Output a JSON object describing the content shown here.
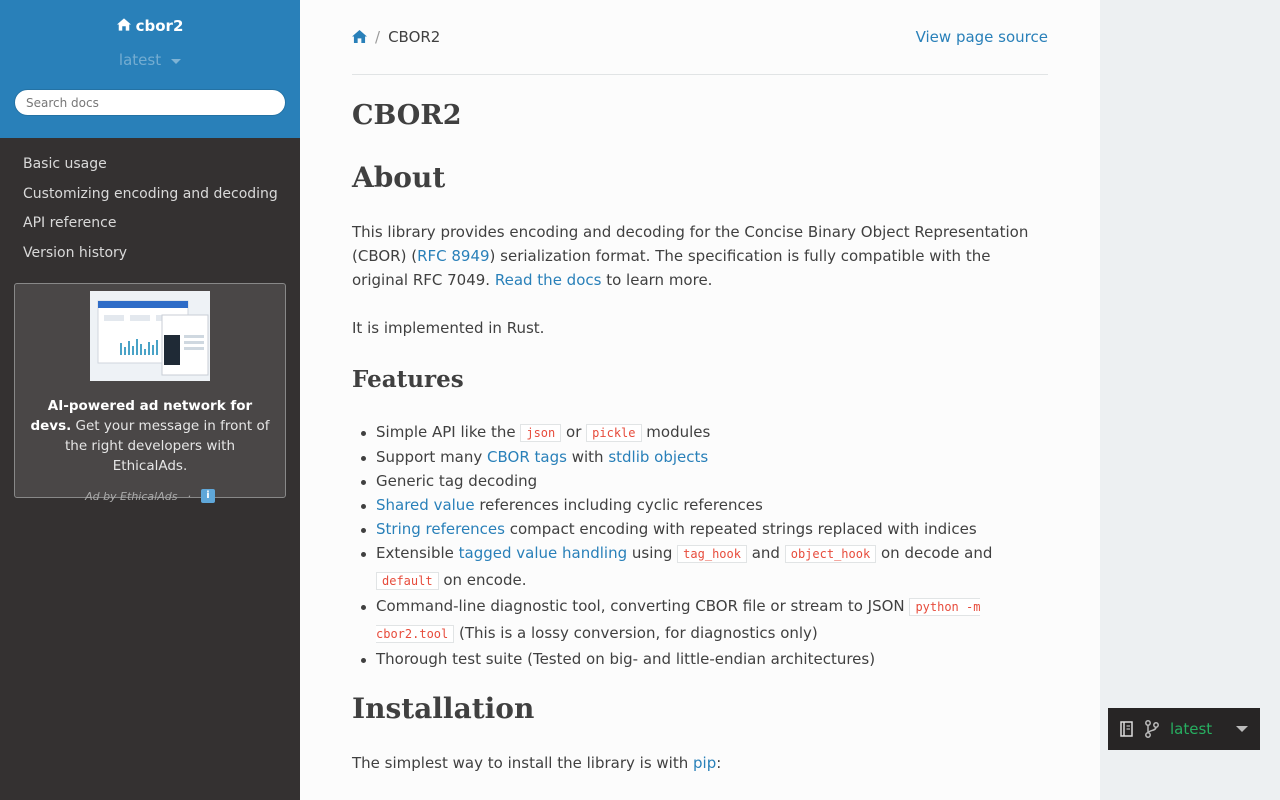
{
  "sidebar": {
    "project_name": "cbor2",
    "version": "latest",
    "search_placeholder": "Search docs",
    "nav": [
      {
        "label": "Basic usage"
      },
      {
        "label": "Customizing encoding and decoding"
      },
      {
        "label": "API reference"
      },
      {
        "label": "Version history"
      }
    ],
    "ad": {
      "headline": "AI-powered ad network for devs.",
      "body": " Get your message in front of the right developers with EthicalAds.",
      "by": "Ad by EthicalAds",
      "dot": "·",
      "info_icon": "i"
    }
  },
  "breadcrumb": {
    "separator": "/",
    "current": "CBOR2",
    "view_source": "View page source"
  },
  "page": {
    "title": "CBOR2",
    "about_heading": "About",
    "about_p1": {
      "a": "This library provides encoding and decoding for the Concise Binary Object Representation (CBOR) (",
      "link1": "RFC 8949",
      "b": ") serialization format. The specification is fully compatible with the original RFC 7049. ",
      "link2": "Read the docs",
      "c": " to learn more."
    },
    "about_p2": "It is implemented in Rust.",
    "features_heading": "Features",
    "features": {
      "f1a": "Simple API like the ",
      "f1c1": "json",
      "f1b": " or ",
      "f1c2": "pickle",
      "f1d": " modules",
      "f2a": "Support many ",
      "f2l1": "CBOR tags",
      "f2b": " with ",
      "f2l2": "stdlib objects",
      "f3": "Generic tag decoding",
      "f4l": "Shared value",
      "f4": " references including cyclic references",
      "f5l": "String references",
      "f5": " compact encoding with repeated strings replaced with indices",
      "f6a": "Extensible ",
      "f6l": "tagged value handling",
      "f6b": " using ",
      "f6c1": "tag_hook",
      "f6c": " and ",
      "f6c2": "object_hook",
      "f6d": " on decode and ",
      "f6c3": "default",
      "f6e": " on encode.",
      "f7a": "Command-line diagnostic tool, converting CBOR file or stream to JSON ",
      "f7c": "python -m cbor2.tool",
      "f7b": " (This is a lossy conversion, for diagnostics only)",
      "f8": "Thorough test suite (Tested on big- and little-endian architectures)"
    },
    "install_heading": "Installation",
    "install_p": {
      "a": "The simplest way to install the library is with ",
      "link": "pip",
      "b": ":"
    }
  },
  "flyout": {
    "version": "latest"
  },
  "colors": {
    "sidebar_top": "#2980b9",
    "sidebar_bg": "#343131",
    "link": "#2980b9",
    "code": "#e74c3c",
    "flyout_version": "#27ae60"
  }
}
